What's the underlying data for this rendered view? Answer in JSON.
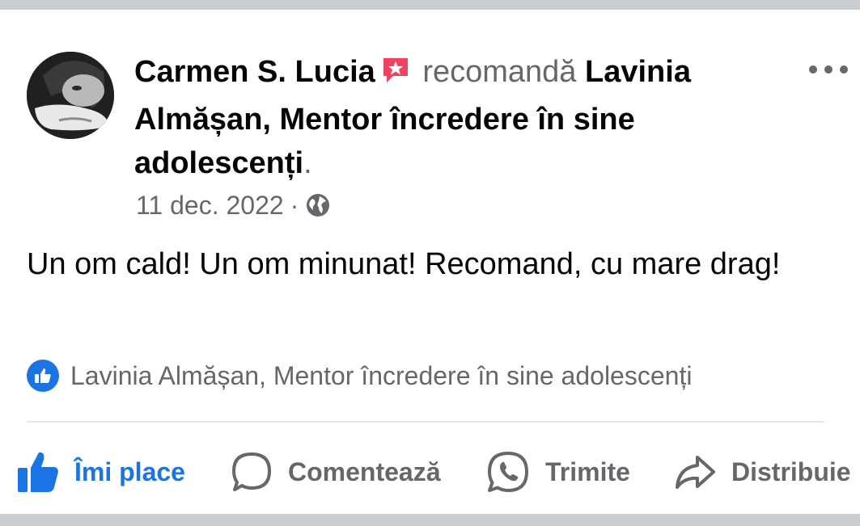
{
  "post": {
    "author": "Carmen S. Lucia",
    "verb": "recomandă",
    "page_name": "Lavinia Almășan, Mentor încredere în sine adolescenți",
    "page_suffix": ".",
    "date": "11 dec. 2022",
    "separator": "·",
    "body": "Un om cald! Un om minunat! Recomand, cu mare drag!",
    "recommendation_label": "Lavinia Almășan, Mentor încredere în sine adolescenți"
  },
  "actions": {
    "like": "Îmi place",
    "comment": "Comentează",
    "send": "Trimite",
    "share": "Distribuie"
  },
  "icons": {
    "more": "more-options-icon",
    "audience": "globe-icon",
    "recommend_badge": "recommend-badge-icon",
    "like": "thumbs-up-icon",
    "comment": "comment-bubble-icon",
    "send": "whatsapp-icon",
    "share": "share-arrow-icon"
  },
  "colors": {
    "accent": "#1b74e4",
    "badge": "#f3425f",
    "secondary_text": "#65676b",
    "primary_text": "#050505"
  }
}
